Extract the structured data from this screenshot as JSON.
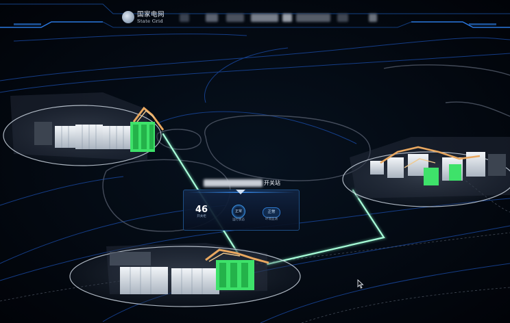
{
  "header": {
    "logo_cn": "国家电网",
    "logo_en": "State Grid"
  },
  "station_panel": {
    "title_suffix": "开关站",
    "metric_value": "46",
    "metric_label": "开关柜",
    "status_center": "正常",
    "status_center_sub": "运行状态",
    "status_right": "正常",
    "status_right_sub": "环境监测"
  },
  "colors": {
    "background": "#02050c",
    "grid_line": "#1b4fb0",
    "link_line": "#7ff0c4",
    "panel_border": "#1d4f86",
    "equipment_green": "#3ee26a"
  }
}
